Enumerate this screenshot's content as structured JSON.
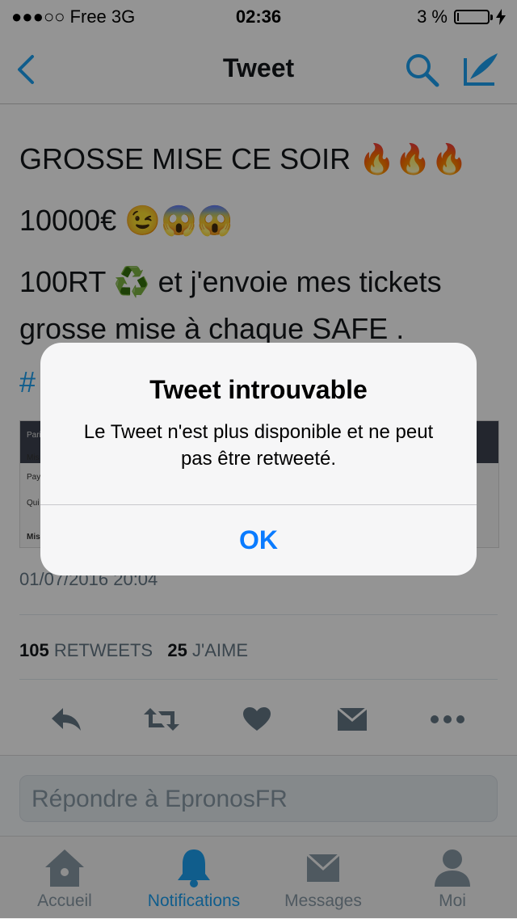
{
  "status_bar": {
    "carrier": "●●●○○ Free   3G",
    "time": "02:36",
    "battery_percent": "3 %",
    "battery_level": 0.03
  },
  "nav": {
    "title": "Tweet",
    "back_icon": "chevron-left-icon",
    "search_icon": "search-icon",
    "compose_icon": "compose-icon"
  },
  "tweet": {
    "line1": "GROSSE MISE CE SOIR 🔥🔥🔥",
    "line2": "10000€ 😉😱😱",
    "line3": "100RT ♻️ et j'envoie mes tickets",
    "line4": "grosse mise à chaque SAFE .",
    "hashtag_fragment": "#",
    "date": "01/07/2016 20:04",
    "retweets_count": "105",
    "retweets_label": "RETWEETS",
    "likes_count": "25",
    "likes_label": "J'AIME",
    "media_snippets": [
      "Pari",
      "Mis",
      "Pay",
      "Qui",
      "Mise"
    ]
  },
  "actions": {
    "reply": "reply-icon",
    "retweet": "retweet-icon",
    "like": "heart-icon",
    "dm": "envelope-icon",
    "more": "more-icon"
  },
  "reply": {
    "placeholder": "Répondre à EpronosFR"
  },
  "tabbar": {
    "tabs": [
      {
        "label": "Accueil",
        "icon": "home-icon",
        "active": false
      },
      {
        "label": "Notifications",
        "icon": "bell-icon",
        "active": true
      },
      {
        "label": "Messages",
        "icon": "envelope-icon",
        "active": false
      },
      {
        "label": "Moi",
        "icon": "person-icon",
        "active": false
      }
    ]
  },
  "alert": {
    "title": "Tweet introuvable",
    "message": "Le Tweet n'est plus disponible et ne peut pas être retweeté.",
    "ok_label": "OK"
  },
  "colors": {
    "accent": "#1da1f2",
    "ios_blue": "#0a7bff",
    "secondary_text": "#657786"
  }
}
